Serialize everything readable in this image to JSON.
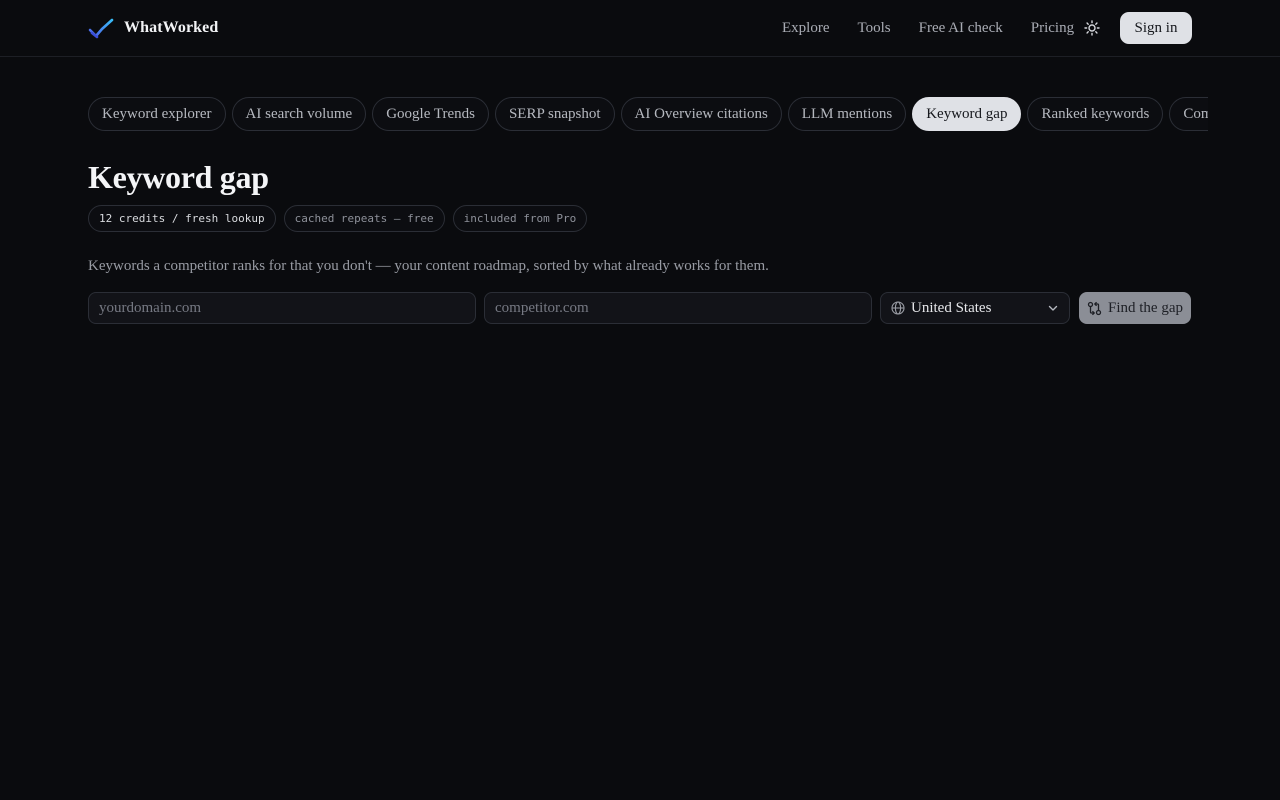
{
  "header": {
    "brand_name": "WhatWorked",
    "brand_icon": "trend-line-logo",
    "nav": [
      "Explore",
      "Tools",
      "Free AI check",
      "Pricing"
    ],
    "theme_icon": "sun-icon",
    "signin_label": "Sign in"
  },
  "tabs": {
    "items": [
      "Keyword explorer",
      "AI search volume",
      "Google Trends",
      "SERP snapshot",
      "AI Overview citations",
      "LLM mentions",
      "Keyword gap",
      "Ranked keywords",
      "Competitors"
    ],
    "active": "Keyword gap"
  },
  "page": {
    "title": "Keyword gap",
    "badges": [
      "12 credits / fresh lookup",
      "cached repeats — free",
      "included from Pro"
    ],
    "description": "Keywords a competitor ranks for that you don't — your content roadmap, sorted by what already works for them."
  },
  "form": {
    "your_domain_placeholder": "yourdomain.com",
    "competitor_placeholder": "competitor.com",
    "country": "United States",
    "country_icon": "globe-icon",
    "submit_label": "Find the gap",
    "submit_icon": "compare-icon"
  },
  "colors": {
    "background": "#0a0b0e",
    "accent_light": "#dfe1e6",
    "logo_blue": "#5b7cfa",
    "logo_cyan": "#38bdf8"
  }
}
